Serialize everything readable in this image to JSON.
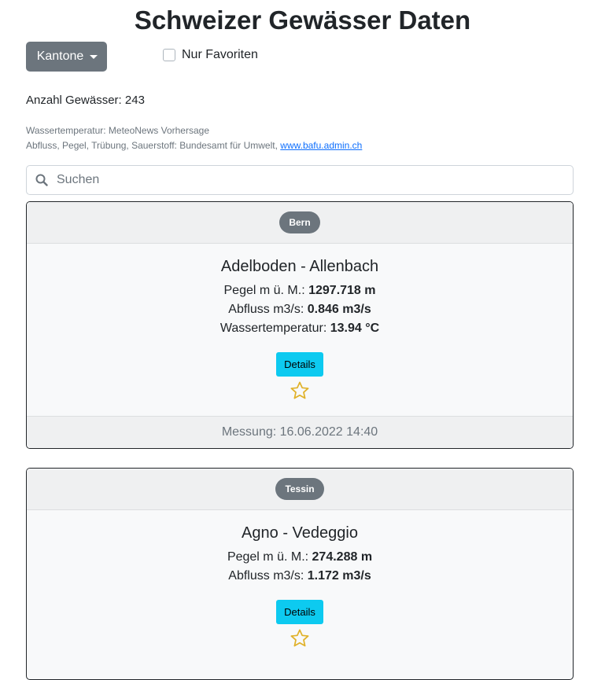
{
  "page": {
    "title": "Schweizer Gewässer Daten",
    "kantone_label": "Kantone",
    "favorites_label": "Nur Favoriten",
    "count_text": "Anzahl Gewässer: 243",
    "source_line1": "Wassertemperatur: MeteoNews Vorhersage",
    "source_line2_prefix": "Abfluss, Pegel, Trübung, Sauerstoff: Bundesamt für Umwelt, ",
    "source_link": "www.bafu.admin.ch",
    "search_placeholder": "Suchen"
  },
  "cards": [
    {
      "canton": "Bern",
      "location": "Adelboden - Allenbach",
      "pegel_label": "Pegel m ü. M.: ",
      "pegel_value": "1297.718 m",
      "abfluss_label": "Abfluss m3/s: ",
      "abfluss_value": "0.846 m3/s",
      "temp_label": "Wassertemperatur: ",
      "temp_value": "13.94 °C",
      "details_label": "Details",
      "measurement": "Messung: 16.06.2022 14:40"
    },
    {
      "canton": "Tessin",
      "location": "Agno - Vedeggio",
      "pegel_label": "Pegel m ü. M.: ",
      "pegel_value": "274.288 m",
      "abfluss_label": "Abfluss m3/s: ",
      "abfluss_value": "1.172 m3/s",
      "details_label": "Details"
    }
  ],
  "icons": {
    "search": "search-icon",
    "star": "star-outline-icon"
  },
  "colors": {
    "badge": "#6c757d",
    "details_button": "#0dcaf0",
    "star": "#e0b22a"
  }
}
